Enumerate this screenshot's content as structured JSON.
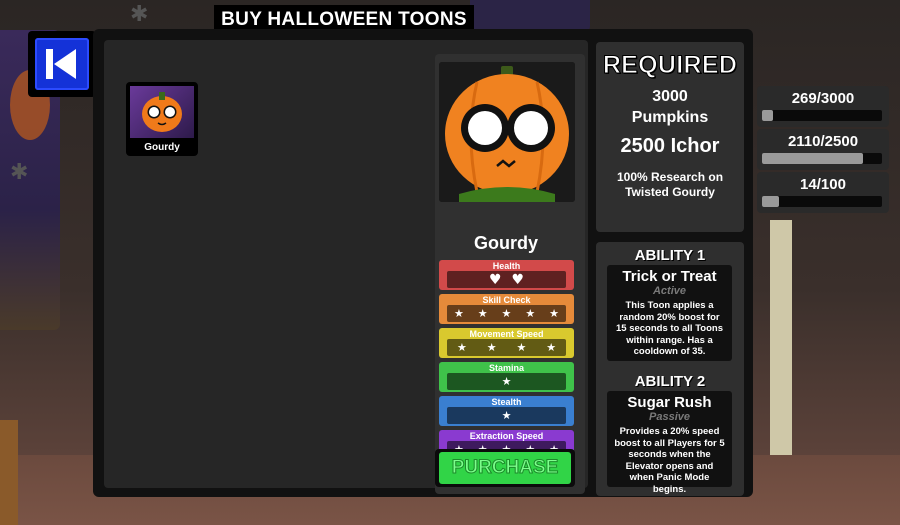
{
  "title": "BUY HALLOWEEN TOONS",
  "toon_list": [
    {
      "name": "Gourdy"
    }
  ],
  "selected": {
    "name": "Gourdy",
    "stats": [
      {
        "label": "Health",
        "kind": "hearts",
        "count": 2,
        "color": "#d24a4a"
      },
      {
        "label": "Skill Check",
        "kind": "stars",
        "count": 5,
        "color": "#e58a3a"
      },
      {
        "label": "Movement Speed",
        "kind": "stars",
        "count": 4,
        "color": "#d9c92e"
      },
      {
        "label": "Stamina",
        "kind": "stars",
        "count": 1,
        "color": "#3fc24a"
      },
      {
        "label": "Stealth",
        "kind": "stars",
        "count": 1,
        "color": "#3a7fd0"
      },
      {
        "label": "Extraction Speed",
        "kind": "stars",
        "count": 5,
        "color": "#8a3ad0"
      }
    ],
    "purchase_label": "PURCHASE"
  },
  "required": {
    "title": "REQUIRED",
    "line1": "3000",
    "line2": "Pumpkins",
    "line3": "2500 Ichor",
    "line4": "100% Research on Twisted Gourdy"
  },
  "progress": [
    {
      "text": "269/3000",
      "fraction": 0.09
    },
    {
      "text": "2110/2500",
      "fraction": 0.84
    },
    {
      "text": "14/100",
      "fraction": 0.14
    }
  ],
  "abilities": [
    {
      "heading": "ABILITY 1",
      "name": "Trick or Treat",
      "type": "Active",
      "description": "This Toon applies a random 20% boost for 15 seconds to all Toons within range. Has a cooldown of 35."
    },
    {
      "heading": "ABILITY 2",
      "name": "Sugar Rush",
      "type": "Passive",
      "description": "Provides a 20% speed boost to all Players for 5 seconds when the Elevator opens and when Panic Mode begins."
    }
  ]
}
